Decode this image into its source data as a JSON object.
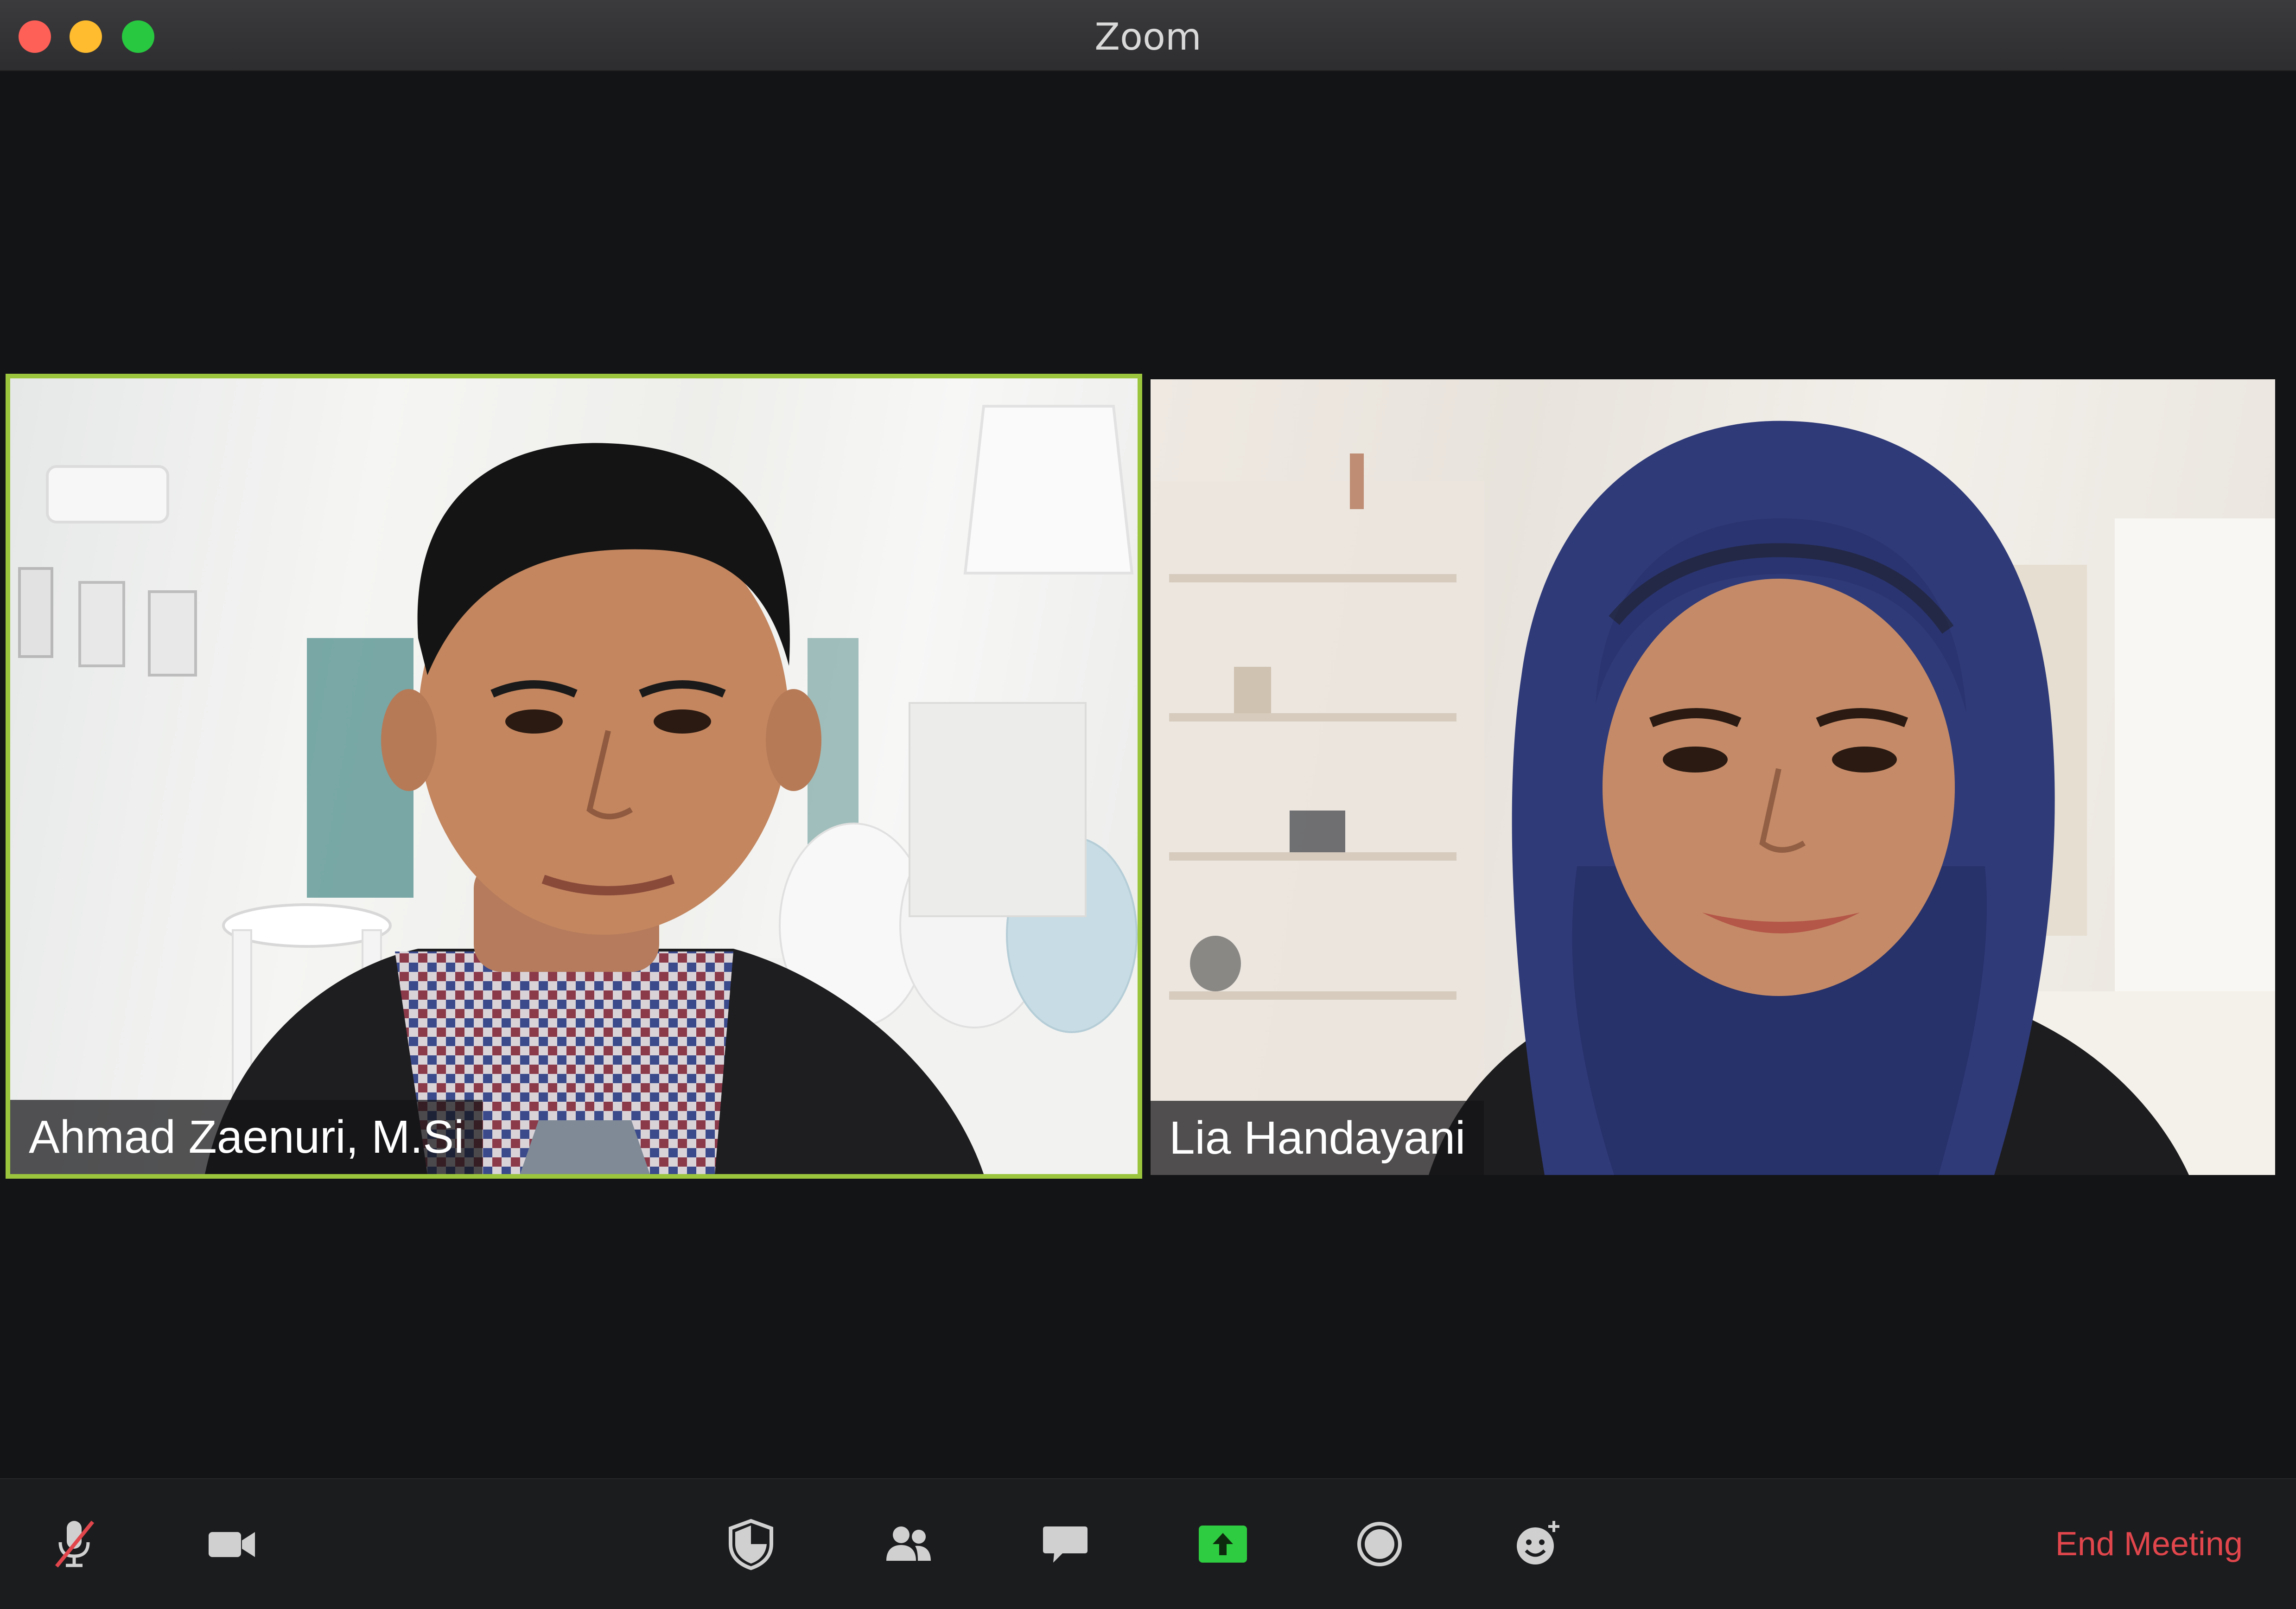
{
  "window": {
    "title": "Zoom"
  },
  "participants": [
    {
      "name": "Ahmad Zaenuri, M.Si",
      "active_speaker": true
    },
    {
      "name": "Lia Handayani",
      "active_speaker": false
    }
  ],
  "toolbar": {
    "buttons": [
      {
        "name": "mute-button",
        "icon": "microphone-muted-icon"
      },
      {
        "name": "video-button",
        "icon": "video-camera-icon"
      },
      {
        "name": "security-button",
        "icon": "shield-icon"
      },
      {
        "name": "participants-button",
        "icon": "people-icon"
      },
      {
        "name": "chat-button",
        "icon": "chat-bubble-icon"
      },
      {
        "name": "share-screen-button",
        "icon": "share-up-arrow-icon"
      },
      {
        "name": "record-button",
        "icon": "record-circle-icon"
      },
      {
        "name": "reactions-button",
        "icon": "smiley-plus-icon"
      }
    ],
    "end_label": "End Meeting"
  },
  "colors": {
    "active_speaker_border": "#9bc53d",
    "share_green": "#2ecc40",
    "end_meeting_red": "#e0464c",
    "background": "#131416"
  }
}
